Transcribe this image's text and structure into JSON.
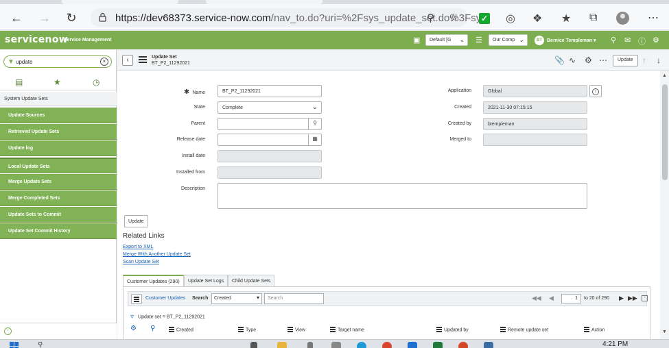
{
  "browser": {
    "url_host": "https://dev68373.service-now.com",
    "url_rest": "/nav_to.do?uri=%2Fsys_update_set.do%3Fsy..."
  },
  "header": {
    "logo": "servicenow",
    "subtitle": "Service Management",
    "update_set_select": "Default [G",
    "company_select": "Our Comp",
    "user_initials": "BT",
    "user_name": "Bernice Templeman",
    "user_caret": "▾"
  },
  "nav": {
    "filter_value": "update",
    "section": "System Update Sets",
    "items": [
      "Update Sources",
      "Retrieved Update Sets",
      "Update log",
      "Local Update Sets",
      "Merge Update Sets",
      "Merge Completed Sets",
      "Update Sets to Commit",
      "Update Set Commit History"
    ]
  },
  "record": {
    "type": "Update Set",
    "name": "BT_P2_11292021",
    "toolbar_update": "Update"
  },
  "form": {
    "labels": {
      "name": "Name",
      "state": "State",
      "parent": "Parent",
      "release_date": "Release date",
      "install_date": "Install date",
      "installed_from": "Installed from",
      "description": "Description",
      "application": "Application",
      "created": "Created",
      "created_by": "Created by",
      "merged_to": "Merged to"
    },
    "values": {
      "name": "BT_P2_11292021",
      "state": "Complete",
      "parent": "",
      "release_date": "",
      "install_date": "",
      "installed_from": "",
      "description": "",
      "application": "Global",
      "created": "2021-11-30 07:15:15",
      "created_by": "btempleman",
      "merged_to": ""
    },
    "update_button": "Update"
  },
  "related_links": {
    "title": "Related Links",
    "links": [
      "Export to XML",
      "Merge With Another Update Set",
      "Scan Update Set"
    ]
  },
  "related_lists": {
    "tabs": [
      "Customer Updates (290)",
      "Update Set Logs",
      "Child Update Sets"
    ],
    "active_tab": 0,
    "list_title": "Customer Updates",
    "search_label": "Search",
    "search_field": "Created",
    "search_placeholder": "Search",
    "page_input": "1",
    "page_range": "to 20 of 290",
    "breadcrumb": "Update set = BT_P2_11292021",
    "columns": [
      "Created",
      "Type",
      "View",
      "Target name",
      "Updated by",
      "Remote update set",
      "Action"
    ]
  },
  "taskbar": {
    "time": "4:21 PM"
  },
  "colors": {
    "brand_green": "#7cae4f",
    "nav_green": "#81b356",
    "link_blue": "#1b62b3"
  }
}
